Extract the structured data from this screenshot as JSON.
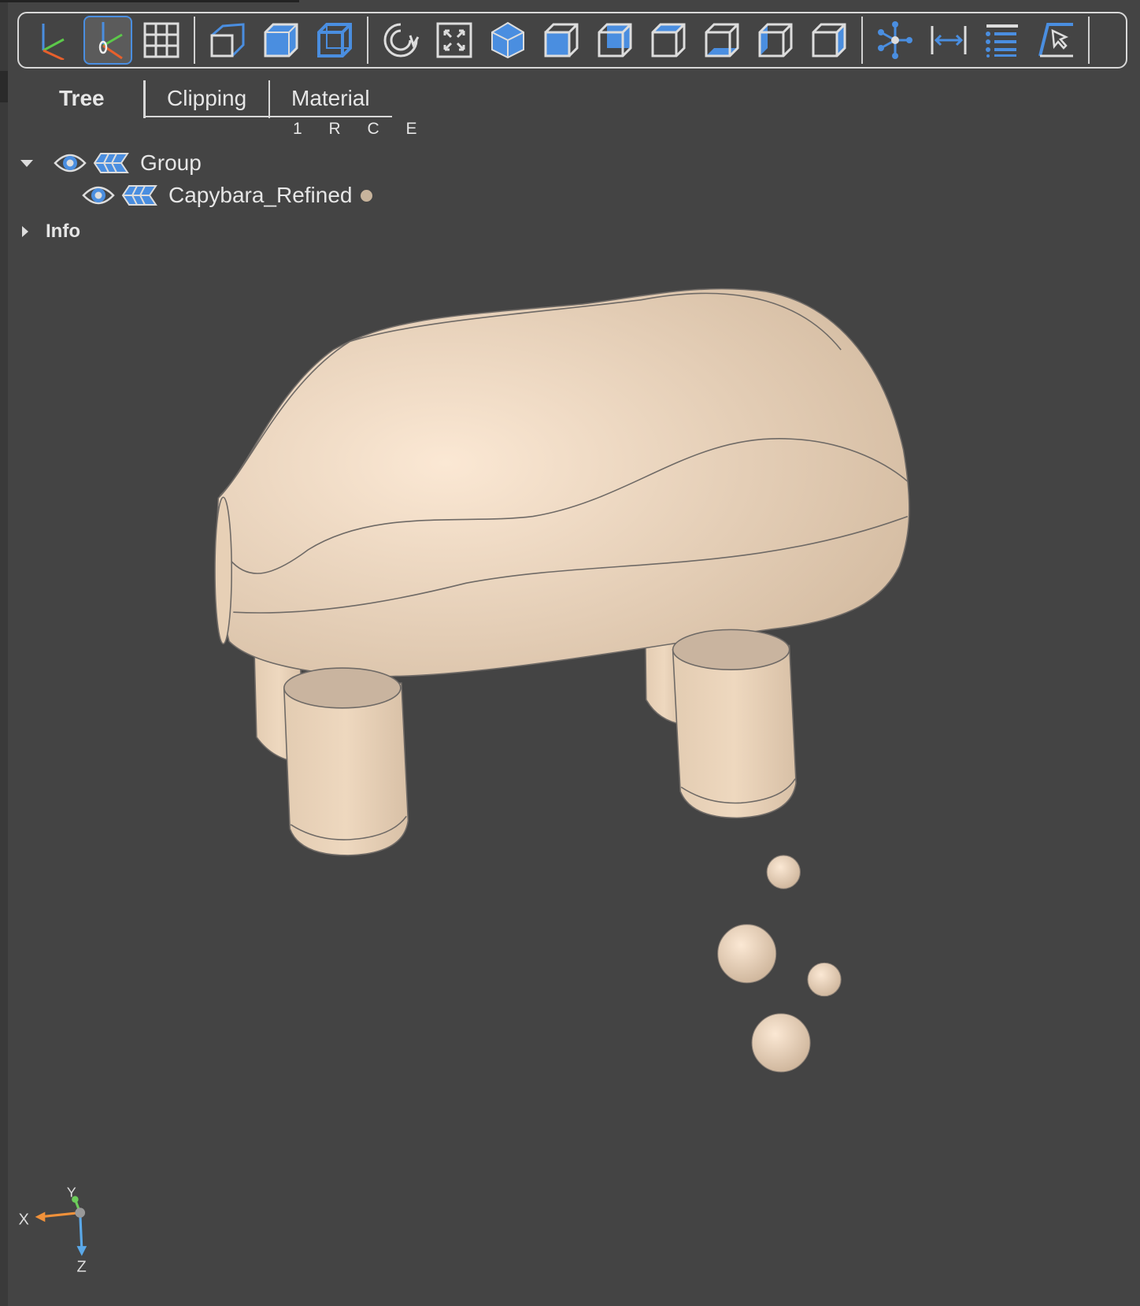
{
  "toolbar": {
    "buttons": [
      {
        "name": "axes-toggle-icon"
      },
      {
        "name": "axes-origin-toggle-icon",
        "active": true
      },
      {
        "name": "grid-toggle-icon"
      },
      {
        "name": "perspective-camera-icon"
      },
      {
        "name": "orthographic-camera-icon"
      },
      {
        "name": "transparent-view-icon"
      },
      {
        "name": "reset-view-icon"
      },
      {
        "name": "fit-view-icon"
      },
      {
        "name": "iso-view-icon"
      },
      {
        "name": "front-view-icon"
      },
      {
        "name": "rear-view-icon"
      },
      {
        "name": "top-view-icon"
      },
      {
        "name": "bottom-view-icon"
      },
      {
        "name": "left-view-icon"
      },
      {
        "name": "right-view-icon"
      },
      {
        "name": "explode-icon"
      },
      {
        "name": "measure-distance-icon"
      },
      {
        "name": "properties-icon"
      },
      {
        "name": "select-object-icon"
      }
    ],
    "accent_color": "#4a8ee0"
  },
  "tabs": {
    "tree": "Tree",
    "clipping": "Clipping",
    "material": "Material"
  },
  "flags": "1 R C E",
  "tree": {
    "group": "Group",
    "child": "Capybara_Refined",
    "info": "Info"
  },
  "axes": {
    "x": "X",
    "y": "Y",
    "z": "Z"
  },
  "model_color": "#efd9bf"
}
